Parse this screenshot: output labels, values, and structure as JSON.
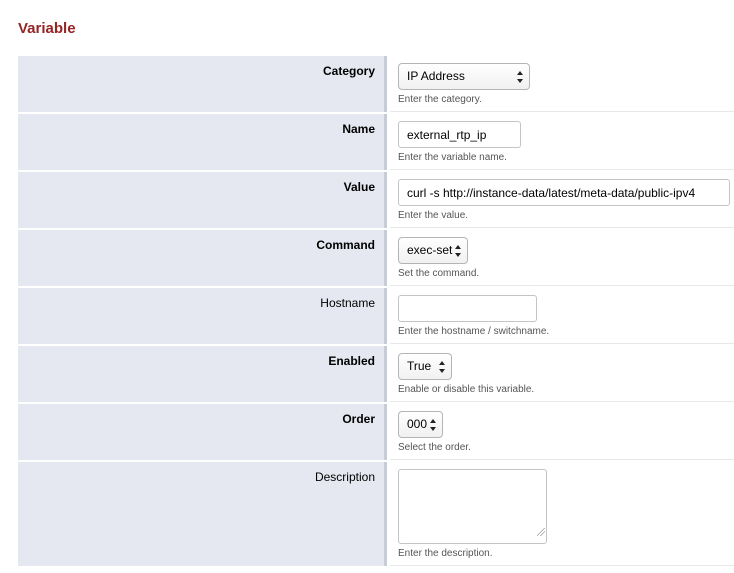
{
  "page": {
    "title": "Variable"
  },
  "fields": [
    {
      "label": "Category",
      "type": "select",
      "value": "IP Address",
      "hint": "Enter the category."
    },
    {
      "label": "Name",
      "type": "text",
      "value": "external_rtp_ip",
      "hint": "Enter the variable name."
    },
    {
      "label": "Value",
      "type": "text",
      "value": "curl -s http://instance-data/latest/meta-data/public-ipv4",
      "hint": "Enter the value."
    },
    {
      "label": "Command",
      "type": "select",
      "value": "exec-set",
      "hint": "Set the command."
    },
    {
      "label": "Hostname",
      "type": "text",
      "value": "",
      "hint": "Enter the hostname / switchname."
    },
    {
      "label": "Enabled",
      "type": "select",
      "value": "True",
      "hint": "Enable or disable this variable."
    },
    {
      "label": "Order",
      "type": "select",
      "value": "000",
      "hint": "Select the order."
    },
    {
      "label": "Description",
      "type": "textarea",
      "value": "",
      "hint": "Enter the description."
    }
  ],
  "icons": {
    "select_arrows": "up-down-chevron-icon"
  },
  "colors": {
    "title": "#952424",
    "label_bg": "#e5e8f0"
  }
}
